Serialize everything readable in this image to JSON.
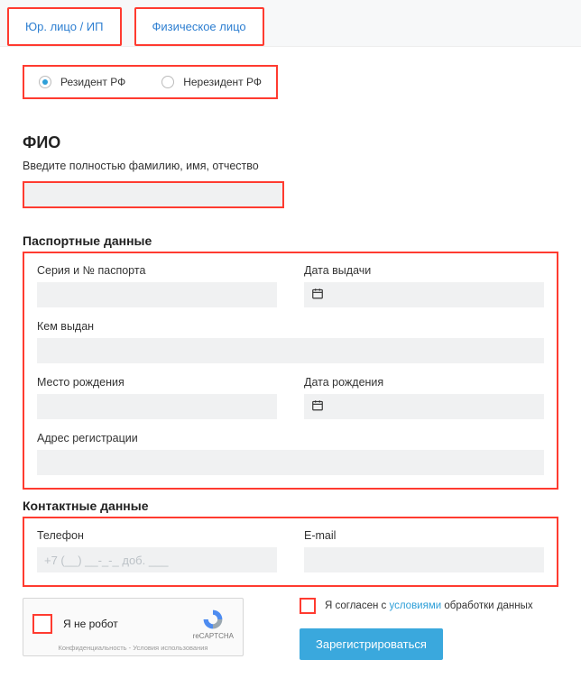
{
  "tabs": {
    "legal": "Юр. лицо / ИП",
    "personal": "Физическое лицо"
  },
  "residency": {
    "resident": "Резидент РФ",
    "nonresident": "Нерезидент РФ"
  },
  "fio": {
    "header": "ФИО",
    "hint": "Введите полностью фамилию, имя, отчество",
    "value": ""
  },
  "passport": {
    "header": "Паспортные данные",
    "series_label": "Серия и № паспорта",
    "series_value": "",
    "issue_date_label": "Дата выдачи",
    "issue_date_value": "",
    "issued_by_label": "Кем выдан",
    "issued_by_value": "",
    "birth_place_label": "Место рождения",
    "birth_place_value": "",
    "birth_date_label": "Дата рождения",
    "birth_date_value": "",
    "reg_address_label": "Адрес регистрации",
    "reg_address_value": ""
  },
  "contacts": {
    "header": "Контактные данные",
    "phone_label": "Телефон",
    "phone_placeholder": "+7 (__) __-_-_ доб. ___",
    "phone_value": "",
    "email_label": "E-mail",
    "email_value": ""
  },
  "captcha": {
    "label": "Я не робот",
    "brand": "reCAPTCHA",
    "footer": "Конфиденциальность - Условия использования"
  },
  "consent": {
    "prefix": "Я согласен с ",
    "link": "условиями",
    "suffix": " обработки данных"
  },
  "submit": "Зарегистрироваться",
  "icons": {
    "calendar": "calendar-icon"
  }
}
